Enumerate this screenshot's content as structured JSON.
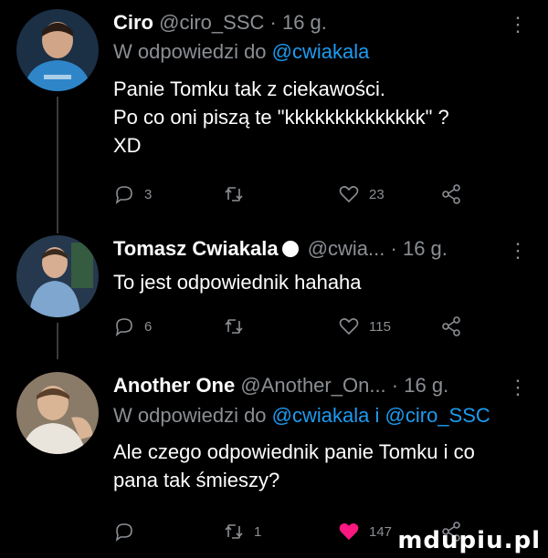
{
  "tweets": [
    {
      "name": "Ciro",
      "handle": "@ciro_SSC",
      "dot": "·",
      "time": "16 g.",
      "reply_prefix": "W odpowiedzi do",
      "reply_mentions": [
        "@cwiakala"
      ],
      "text_lines": [
        "Panie Tomku tak z ciekawości.",
        "Po co oni piszą te \"kkkkkkkkkkkkkk\" ?",
        "XD"
      ],
      "replies": "3",
      "retweets": "",
      "likes": "23",
      "liked": false,
      "avatar_colors": [
        "#2e6f9e",
        "#1f3b57"
      ]
    },
    {
      "name": "Tomasz Cwiakala",
      "handle": "@cwia...",
      "dot": "·",
      "time": "16 g.",
      "verified": true,
      "text_lines": [
        "To jest odpowiednik hahaha"
      ],
      "replies": "6",
      "retweets": "",
      "likes": "115",
      "liked": false,
      "avatar_colors": [
        "#4a6b8a",
        "#1c2a3a"
      ]
    },
    {
      "name": "Another One",
      "handle": "@Another_On...",
      "dot": "·",
      "time": "16 g.",
      "reply_prefix": "W odpowiedzi do",
      "reply_mentions": [
        "@cwiakala",
        "@ciro_SSC"
      ],
      "reply_joiner": "i",
      "text_lines": [
        "Ale czego odpowiednik panie Tomku i co",
        "pana tak śmieszy?"
      ],
      "replies": "",
      "retweets": "1",
      "likes": "147",
      "liked": true,
      "avatar_colors": [
        "#c9b29a",
        "#6b5a48"
      ]
    }
  ],
  "colors": {
    "background": "#000000",
    "muted": "#8b8f94",
    "link": "#1d9bf0",
    "like": "#f91880"
  },
  "watermark": "mdupiu.pl"
}
